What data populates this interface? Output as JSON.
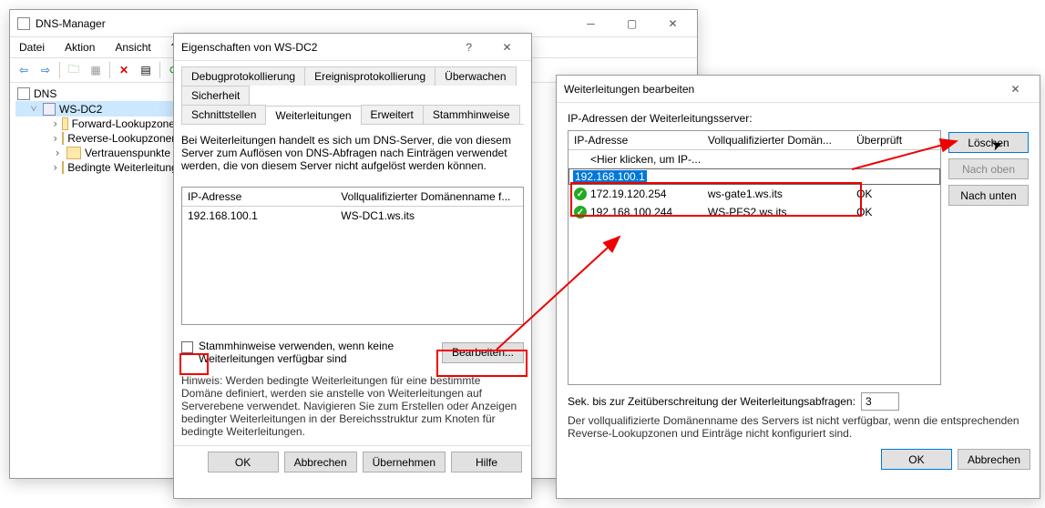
{
  "mgr": {
    "title": "DNS-Manager",
    "menu": {
      "file": "Datei",
      "action": "Aktion",
      "view": "Ansicht",
      "help": "?"
    },
    "tree": {
      "root": "DNS",
      "server": "WS-DC2",
      "items": [
        "Forward-Lookupzone",
        "Reverse-Lookupzonen",
        "Vertrauenspunkte",
        "Bedingte Weiterleitungen"
      ]
    }
  },
  "props": {
    "title": "Eigenschaften von WS-DC2",
    "tabs_row1": [
      "Debugprotokollierung",
      "Ereignisprotokollierung",
      "Überwachen",
      "Sicherheit"
    ],
    "tabs_row2": [
      "Schnittstellen",
      "Weiterleitungen",
      "Erweitert",
      "Stammhinweise"
    ],
    "active_tab": "Weiterleitungen",
    "desc": "Bei Weiterleitungen handelt es sich um DNS-Server, die von diesem Server zum Auflösen von DNS-Abfragen nach Einträgen verwendet werden, die von diesem Server nicht aufgelöst werden können.",
    "cols": {
      "ip": "IP-Adresse",
      "fqdn": "Vollqualifizierter Domänenname f..."
    },
    "rows": [
      {
        "ip": "192.168.100.1",
        "fqdn": "WS-DC1.ws.its"
      }
    ],
    "checkbox_label": "Stammhinweise verwenden, wenn keine Weiterleitungen verfügbar sind",
    "edit_btn": "Bearbeiten...",
    "hint": "Hinweis: Werden bedingte Weiterleitungen für eine bestimmte Domäne definiert, werden sie anstelle von Weiterleitungen auf Serverebene verwendet. Navigieren Sie zum Erstellen oder Anzeigen bedingter Weiterleitungen in der Bereichsstruktur zum Knoten für bedingte Weiterleitungen.",
    "buttons": {
      "ok": "OK",
      "cancel": "Abbrechen",
      "apply": "Übernehmen",
      "help": "Hilfe"
    }
  },
  "edit": {
    "title": "Weiterleitungen bearbeiten",
    "label": "IP-Adressen der Weiterleitungsserver:",
    "cols": {
      "ip": "IP-Adresse",
      "fqdn": "Vollqualifizierter Domän...",
      "ok": "Überprüft"
    },
    "placeholder_row": "<Hier klicken, um IP-...",
    "sel_ip": "192.168.100.1",
    "rows": [
      {
        "ip": "172.19.120.254",
        "fqdn": "ws-gate1.ws.its",
        "ok": "OK"
      },
      {
        "ip": "192.168.100.244",
        "fqdn": "WS-PFS2.ws.its",
        "ok": "OK"
      }
    ],
    "side": {
      "del": "Löschen",
      "up": "Nach oben",
      "down": "Nach unten"
    },
    "timeout_label": "Sek. bis zur Zeitüberschreitung der Weiterleitungsabfragen:",
    "timeout_value": "3",
    "note": "Der vollqualifizierte Domänenname des Servers ist nicht verfügbar, wenn die entsprechenden Reverse-Lookupzonen und Einträge nicht konfiguriert sind.",
    "buttons": {
      "ok": "OK",
      "cancel": "Abbrechen"
    }
  }
}
